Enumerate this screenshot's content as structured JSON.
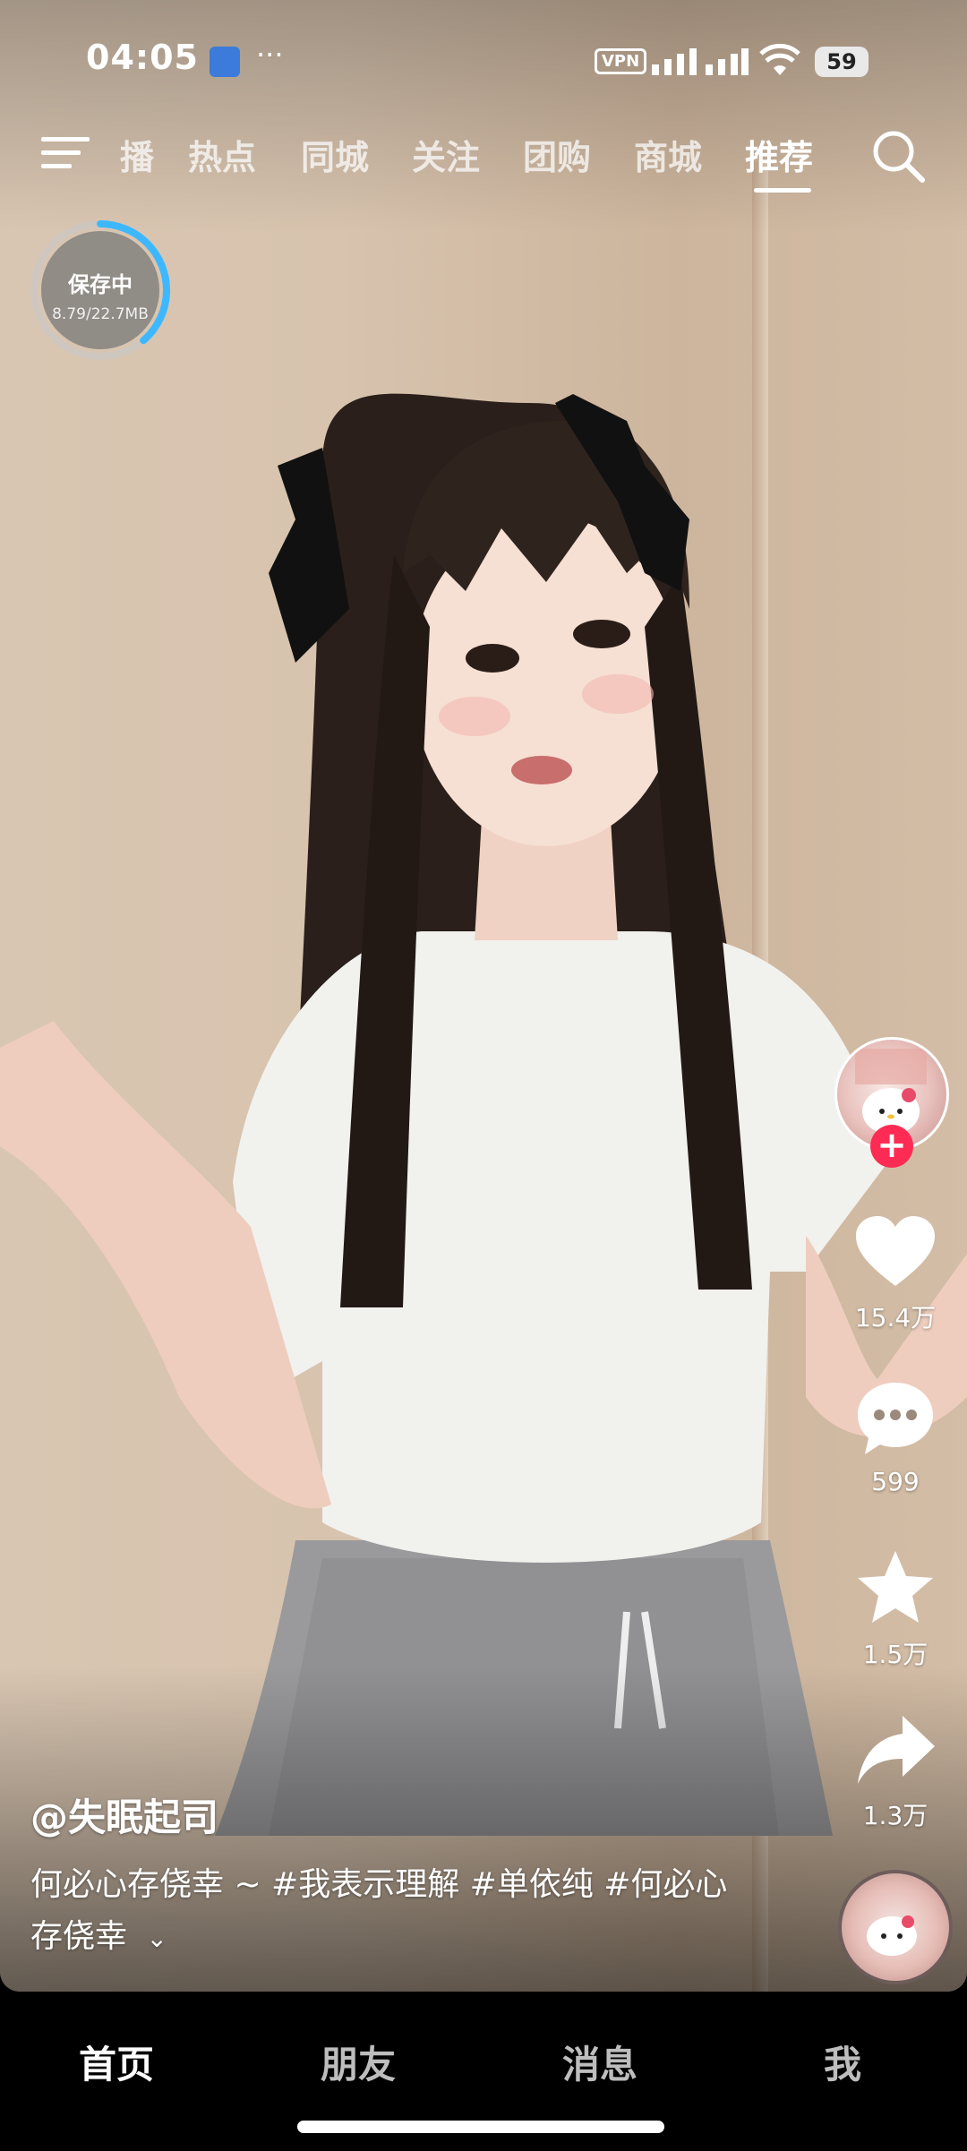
{
  "status_bar": {
    "time": "04:05",
    "dots": "···",
    "vpn": "VPN",
    "battery": "59"
  },
  "top_nav": {
    "tabs": [
      {
        "label": "播"
      },
      {
        "label": "热点"
      },
      {
        "label": "同城"
      },
      {
        "label": "关注"
      },
      {
        "label": "团购"
      },
      {
        "label": "商城"
      },
      {
        "label": "推荐"
      }
    ],
    "active_tab": "推荐"
  },
  "saving_badge": {
    "title": "保存中",
    "progress_text": "8.79/22.7MB",
    "progress_fraction": 0.387
  },
  "actions": {
    "likes": "15.4万",
    "comments": "599",
    "favorites": "1.5万",
    "shares": "1.3万"
  },
  "video": {
    "author": "@失眠起司",
    "description": "何必心存侥幸 ~ #我表示理解 #单依纯 #何必心存侥幸",
    "expand_icon": "chevron-down-icon"
  },
  "bottom_nav": {
    "tabs": [
      "首页",
      "朋友",
      "消息",
      "我"
    ],
    "active": "首页"
  },
  "colors": {
    "follow_button": "#fe2c55",
    "progress_ring": "#3db8ff",
    "bottom_bar": "#000000"
  }
}
